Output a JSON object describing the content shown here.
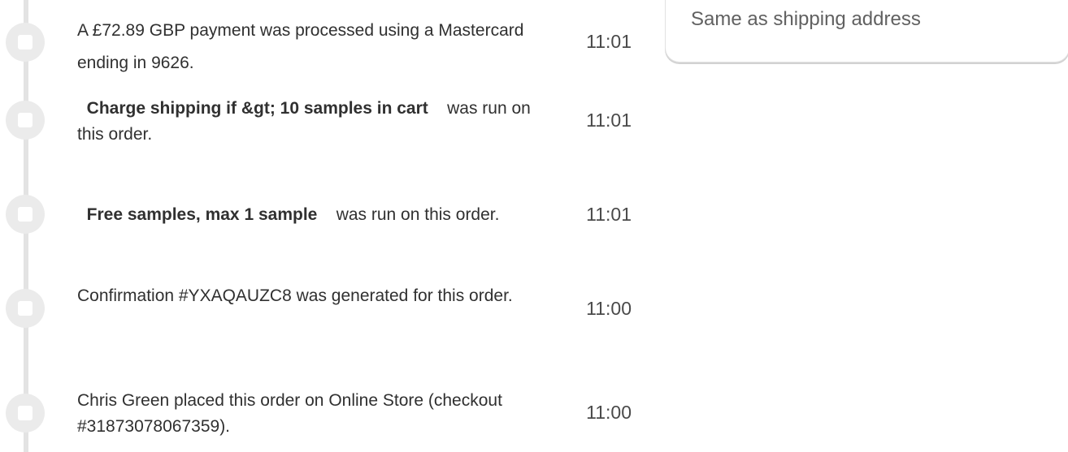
{
  "timeline": {
    "events": [
      {
        "id": "payment",
        "text": "A £72.89 GBP payment was processed using a Mastercard ending in 9626.",
        "time": "11:01"
      },
      {
        "id": "shipping-script",
        "bold": "Charge shipping if &gt; 10 samples in cart",
        "text": "was run on this order.",
        "time": "11:01"
      },
      {
        "id": "samples-script",
        "bold": "Free samples, max 1 sample",
        "text": "was run on this order.",
        "time": "11:01"
      },
      {
        "id": "confirmation",
        "text": "Confirmation #YXAQAUZC8 was generated for this order.",
        "time": "11:00"
      },
      {
        "id": "order-placed",
        "text": "Chris Green placed this order on Online Store (checkout #31873078067359).",
        "time": "11:00"
      }
    ]
  },
  "billing_card": {
    "text": "Same as shipping address"
  }
}
